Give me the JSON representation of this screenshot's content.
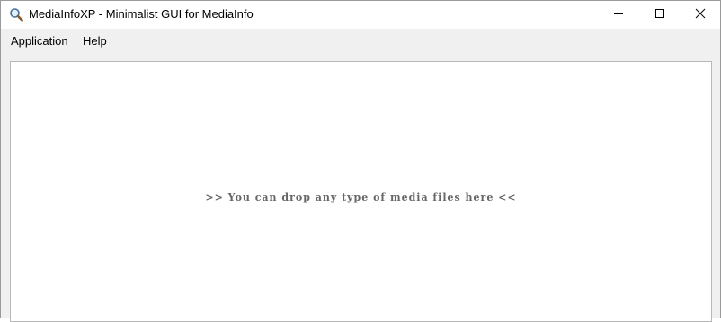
{
  "window": {
    "title": "MediaInfoXP - Minimalist GUI for MediaInfo",
    "icon": "magnifier-icon",
    "controls": {
      "minimize": "minimize-icon",
      "maximize": "maximize-icon",
      "close": "close-icon"
    }
  },
  "menu": {
    "items": [
      {
        "label": "Application"
      },
      {
        "label": "Help"
      }
    ]
  },
  "drop_area": {
    "hint": ">> You can drop any type of media files here <<"
  },
  "colors": {
    "hint_text": "#666666",
    "window_bg": "#f0f0f0",
    "content_bg": "#ffffff"
  }
}
